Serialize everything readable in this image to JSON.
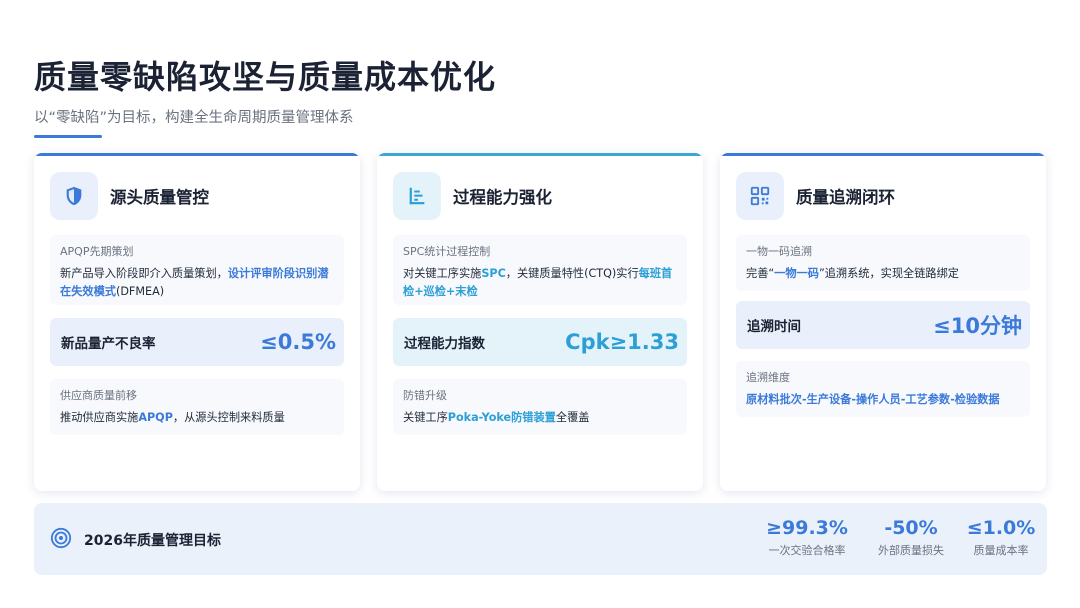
{
  "header": {
    "title": "质量零缺陷攻坚与质量成本优化",
    "subtitle": "以“零缺陷”为目标，构建全生命周期质量管理体系"
  },
  "colors": {
    "accent": "#3b7ad9",
    "accent_cyan": "#2b9fd6"
  },
  "cards": [
    {
      "icon": "shield-icon",
      "title": "源头质量管控",
      "block1": {
        "label": "APQP先期策划",
        "text_a": "新产品导入阶段即介入质量策划，",
        "hl": "设计评审阶段识别潜在失效模式",
        "text_b": "(DFMEA)"
      },
      "metric": {
        "label": "新品量产不良率",
        "value": "≤0.5%"
      },
      "block2": {
        "label": "供应商质量前移",
        "text_a": "推动供应商实施",
        "hl": "APQP",
        "text_b": "，从源头控制来料质量"
      }
    },
    {
      "icon": "chart-icon",
      "title": "过程能力强化",
      "block1": {
        "label": "SPC统计过程控制",
        "text_a": "对关键工序实施",
        "hl": "SPC",
        "text_b": "，关键质量特性(CTQ)实行",
        "hl2": "每班首检+巡检+末检"
      },
      "metric": {
        "label": "过程能力指数",
        "value": "Cpk≥1.33"
      },
      "block2": {
        "label": "防错升级",
        "text_a": "关键工序",
        "hl": "Poka-Yoke防错装置",
        "text_b": "全覆盖"
      }
    },
    {
      "icon": "qrcode-icon",
      "title": "质量追溯闭环",
      "block1": {
        "label": "一物一码追溯",
        "text_a": "完善“",
        "hl": "一物一码",
        "text_b": "”追溯系统，实现全链路绑定"
      },
      "metric": {
        "label": "追溯时间",
        "value": "≤10分钟"
      },
      "block2": {
        "label": "追溯维度",
        "hl": "原材料批次-生产设备-操作人员-工艺参数-检验数据"
      }
    }
  ],
  "goals": {
    "icon": "target-icon",
    "title": "2026年质量管理目标",
    "items": [
      {
        "value": "≥99.3%",
        "label": "一次交验合格率"
      },
      {
        "value": "-50%",
        "label": "外部质量损失"
      },
      {
        "value": "≤1.0%",
        "label": "质量成本率"
      }
    ]
  }
}
